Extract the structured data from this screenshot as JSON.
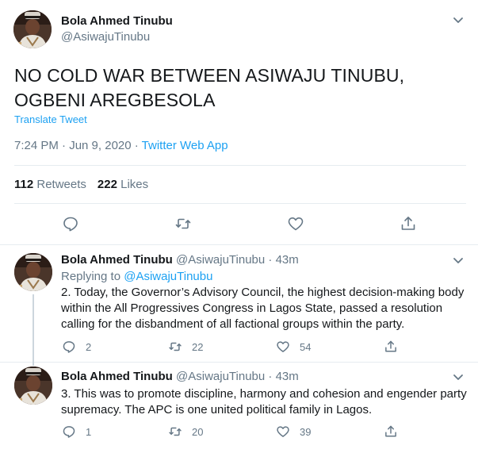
{
  "main_tweet": {
    "author_name": "Bola Ahmed Tinubu",
    "author_handle": "@AsiwajuTinubu",
    "text": "NO COLD WAR BETWEEN ASIWAJU TINUBU, OGBENI AREGBESOLA",
    "translate_label": "Translate Tweet",
    "time_date": "7:24 PM · Jun 9, 2020 · ",
    "source_app": "Twitter Web App",
    "retweets_count": "112",
    "retweets_label": "Retweets",
    "likes_count": "222",
    "likes_label": "Likes",
    "icons": [
      "reply-icon",
      "retweet-icon",
      "like-icon",
      "share-icon"
    ]
  },
  "replies": [
    {
      "author_name": "Bola Ahmed Tinubu",
      "author_handle": "@AsiwajuTinubu · 43m",
      "replying_prefix": "Replying to ",
      "replying_to": "@AsiwajuTinubu",
      "text": "2. Today, the Governor’s Advisory Council, the highest decision-making body within the All Progressives Congress in Lagos State, passed a resolution calling for the disbandment of all factional groups within the party.",
      "reply_count": "2",
      "retweet_count": "22",
      "like_count": "54"
    },
    {
      "author_name": "Bola Ahmed Tinubu",
      "author_handle": "@AsiwajuTinubu · 43m",
      "text": "3. This was to promote discipline, harmony and cohesion and engender party supremacy. The APC is one united political family in Lagos.",
      "reply_count": "1",
      "retweet_count": "20",
      "like_count": "39"
    }
  ],
  "colors": {
    "accent": "#1da1f2",
    "secondary_text": "#657786",
    "primary_text": "#14171a",
    "border": "#e6ecf0",
    "thread_line": "#ccd6dd"
  }
}
